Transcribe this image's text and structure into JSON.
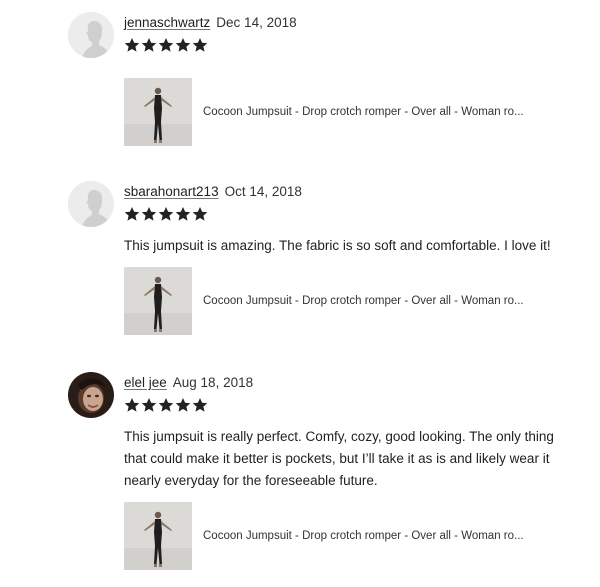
{
  "reviews": [
    {
      "username": "jennaschwartz",
      "date": "Dec 14, 2018",
      "rating": 5,
      "text": "",
      "product_title": "Cocoon Jumpsuit - Drop crotch romper - Over all - Woman ro...",
      "avatar": "default-person-icon"
    },
    {
      "username": "sbarahonart213",
      "date": "Oct 14, 2018",
      "rating": 5,
      "text": "This jumpsuit is amazing. The fabric is so soft and comfortable. I love it!",
      "product_title": "Cocoon Jumpsuit - Drop crotch romper - Over all - Woman ro...",
      "avatar": "default-person-icon"
    },
    {
      "username": "elel jee",
      "date": "Aug 18, 2018",
      "rating": 5,
      "text": "This jumpsuit is really perfect. Comfy, cozy, good looking. The only thing that could make it better is pockets, but I’ll take it as is and likely wear it nearly everyday for the foreseeable future.",
      "product_title": "Cocoon Jumpsuit - Drop crotch romper - Over all - Woman ro...",
      "avatar": "user-photo"
    }
  ],
  "colors": {
    "star": "#222222",
    "avatar_bg": "#ececec",
    "avatar_silhouette": "#cfcfcf"
  }
}
